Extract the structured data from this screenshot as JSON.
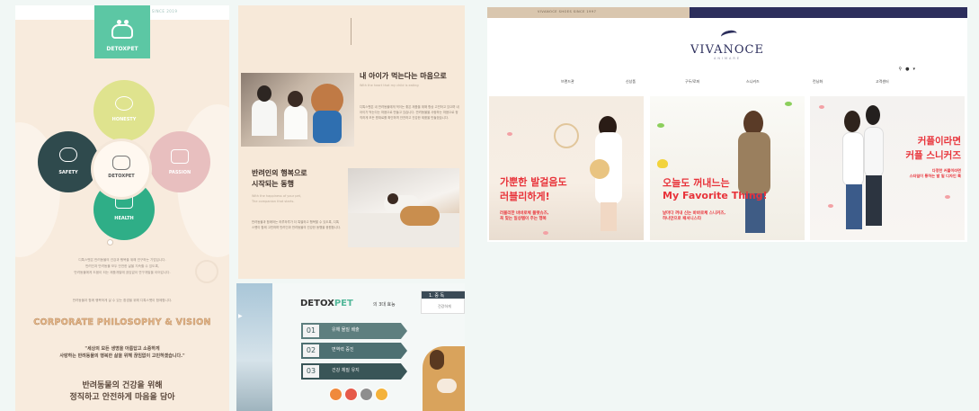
{
  "panel1": {
    "topbar_text": "Dedicated Canine Care · SINCE 2019",
    "logo": "DETOXPET",
    "center_label": "DETOXPET",
    "values": [
      "HONESTY",
      "PASSION",
      "HEALTH",
      "SAFETY"
    ],
    "para1": "디톡스펫은 반려동물의 건강과 행복을 위해 연구하는 기업입니다.",
    "para2": "반려인과 반려동물 모두 안전한 삶을 지속할 수 있도록,",
    "para3": "반려동물에게 도움이 되는 제품개발에 끊임없이 연구개발을 이어갑니다.",
    "para4": "반려동물과 함께 행복하게 살 수 있는 환경을 위해 디톡스펫이 함께합니다.",
    "vision_title": "CORPORATE PHILOSOPHY & VISION",
    "quote_line1": "\"세상의 모든 생명을 아름답고 소중하게",
    "quote_line2": "사랑하는 반려동물의 행복한 삶을 위해 끊임없이 고민하겠습니다.\"",
    "big_line1": "반려동물의 건강을 위해",
    "big_line2": "정직하고 안전하게 마음을 담아"
  },
  "panel2": {
    "heading1": "내 아이가 먹는다는 마음으로",
    "sub1": "With the heart that my child is eating",
    "body1": "디톡스펫은 내 반려동물에게 먹이는 좋은 제품을 위해 항상 고민하고 있으며 내 아이가 먹는다는 마음으로 만들고 있습니다. 반려동물을 사랑하는 마음으로 정직하게 모든 원재료를 확인하며 안전하고 건강한 제품을 만들겠습니다.",
    "heading2_line1": "반려인의 행복으로",
    "heading2_line2": "시작되는 동행",
    "sub2_line1": "With the happiness of your pet,",
    "sub2_line2": "The companion that starts.",
    "body2": "반려동물과 함께하는 하루하루가 더 특별하고 행복할 수 있도록, 디톡스펫이 함께 고민하며 반려인과 반려동물의 건강한 동행을 응원합니다."
  },
  "panel3": {
    "logo_main": "DETOX",
    "logo_accent": "PET",
    "logo_sub": "의 3대 효능",
    "steps": [
      {
        "num": "01",
        "label": "유해 물질 배출"
      },
      {
        "num": "02",
        "label": "면역력 증진"
      },
      {
        "num": "03",
        "label": "건강 체질 유지"
      }
    ],
    "card_title": "1. 중 독",
    "card_text": "건강하게",
    "dot_colors": [
      "#f08a3c",
      "#e65a4a",
      "#8e8e8e",
      "#f4b23a"
    ]
  },
  "panel4": {
    "since": "VIVANOCE SHOES SINCE 1997",
    "top_links": [
      "로그인",
      "회원가입",
      "마이페이지",
      "장바구니"
    ],
    "brand": "VIVANOCE",
    "brand_sub": "ANIMARE",
    "nav": [
      "브랜드관",
      "신상품",
      "구두/로퍼",
      "스니커즈",
      "런닝화",
      "고객센터"
    ],
    "banner1": {
      "headline_line1": "가뿐한 발걸음도",
      "headline_line2": "러블리하게!",
      "copy_line1": "러블리한 바바로체 플랫슈즈,",
      "copy_line2": "꼭 맞는 일상템이 주는 행복"
    },
    "banner2": {
      "headline_line1": "오늘도 꺼내느는",
      "headline_line2": "My Favorite Thing!",
      "copy_line1": "날마다 꺼내 신는 바바로체 스니커즈,",
      "copy_line2": "하나만으로 패셔니스타"
    },
    "banner3": {
      "headline_line1": "커플이라면",
      "headline_line2": "커플 스니커즈",
      "copy_line1": "다정한 커플이라면",
      "copy_line2": "스타일이 통하는 발 밑 디자인 룩"
    }
  }
}
